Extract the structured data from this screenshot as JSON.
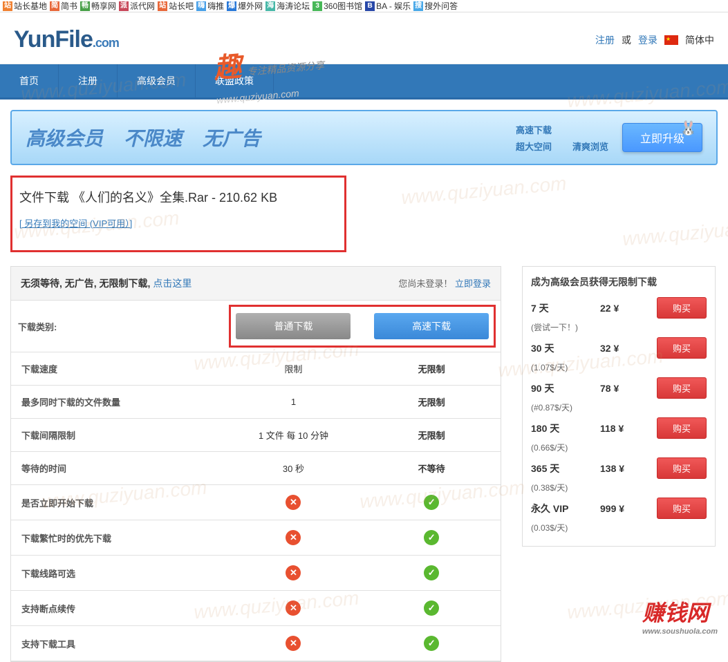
{
  "bookmarks": [
    {
      "label": "站长基地",
      "color": "#f08030"
    },
    {
      "label": "简书",
      "color": "#e8683a"
    },
    {
      "label": "畅享网",
      "color": "#48a048"
    },
    {
      "label": "派代网",
      "color": "#c8485a"
    },
    {
      "label": "站长吧",
      "color": "#e8683a"
    },
    {
      "label": "嗨推",
      "color": "#48a0e8"
    },
    {
      "label": "爆外网",
      "color": "#2878d8"
    },
    {
      "label": "海涛论坛",
      "color": "#48b8a8"
    },
    {
      "label": "360图书馆",
      "color": "#48b858"
    },
    {
      "label": "BA - 娱乐",
      "color": "#2848a8"
    },
    {
      "label": "搜外问答",
      "color": "#48a8e8"
    }
  ],
  "logo": {
    "main": "YunFile",
    "suffix": ".com"
  },
  "header": {
    "register": "注册",
    "or": "或",
    "login": "登录",
    "lang": "简体中"
  },
  "nav": [
    "首页",
    "注册",
    "高级会员",
    "联盟政策"
  ],
  "banner": {
    "texts": [
      "高级会员",
      "不限速",
      "无广告"
    ],
    "features": [
      [
        "高速下载"
      ],
      [
        "超大空间"
      ],
      [
        "清爽浏览"
      ]
    ],
    "upgrade": "立即升级"
  },
  "file": {
    "prefix": "文件下载  ",
    "name": "《人们的名义》全集.Rar - 210.62 KB",
    "save_link": "[ 另存到我的空间 (VIP可用）]"
  },
  "tip": {
    "text": "无须等待, 无广告, 无限制下载, ",
    "link": "点击这里",
    "login_prompt": "您尚未登录！",
    "login_link": "立即登录"
  },
  "table": {
    "category": "下载类别:",
    "btn_normal": "普通下载",
    "btn_fast": "高速下载",
    "rows": [
      {
        "label": "下载速度",
        "normal": "限制",
        "fast": "无限制"
      },
      {
        "label": "最多同时下载的文件数量",
        "normal": "1",
        "fast": "无限制"
      },
      {
        "label": "下载间隔限制",
        "normal": "1 文件 每 10 分钟",
        "fast": "无限制"
      },
      {
        "label": "等待的时间",
        "normal": "30 秒",
        "fast": "不等待"
      }
    ],
    "bool_rows": [
      "是否立即开始下载",
      "下载繁忙时的优先下载",
      "下载线路可选",
      "支持断点续传",
      "支持下载工具"
    ]
  },
  "vip": {
    "title": "成为高级会员获得无限制下载",
    "buy": "购买",
    "plans": [
      {
        "period": "7 天",
        "price": "22 ¥",
        "sub": "(尝试一下！)"
      },
      {
        "period": "30 天",
        "price": "32 ¥",
        "sub": "(1.07$/天)"
      },
      {
        "period": "90 天",
        "price": "78 ¥",
        "sub": "(#0.87$/天)"
      },
      {
        "period": "180 天",
        "price": "118 ¥",
        "sub": "(0.66$/天)"
      },
      {
        "period": "365 天",
        "price": "138 ¥",
        "sub": "(0.38$/天)"
      },
      {
        "period": "永久 VIP",
        "price": "999 ¥",
        "sub": "(0.03$/天)"
      }
    ]
  },
  "watermark": {
    "text": "www.quziyuan.com",
    "tagline": "专注精品资源分享",
    "bottom_logo": "赚钱网",
    "bottom_sub": "www.soushuola.com"
  }
}
